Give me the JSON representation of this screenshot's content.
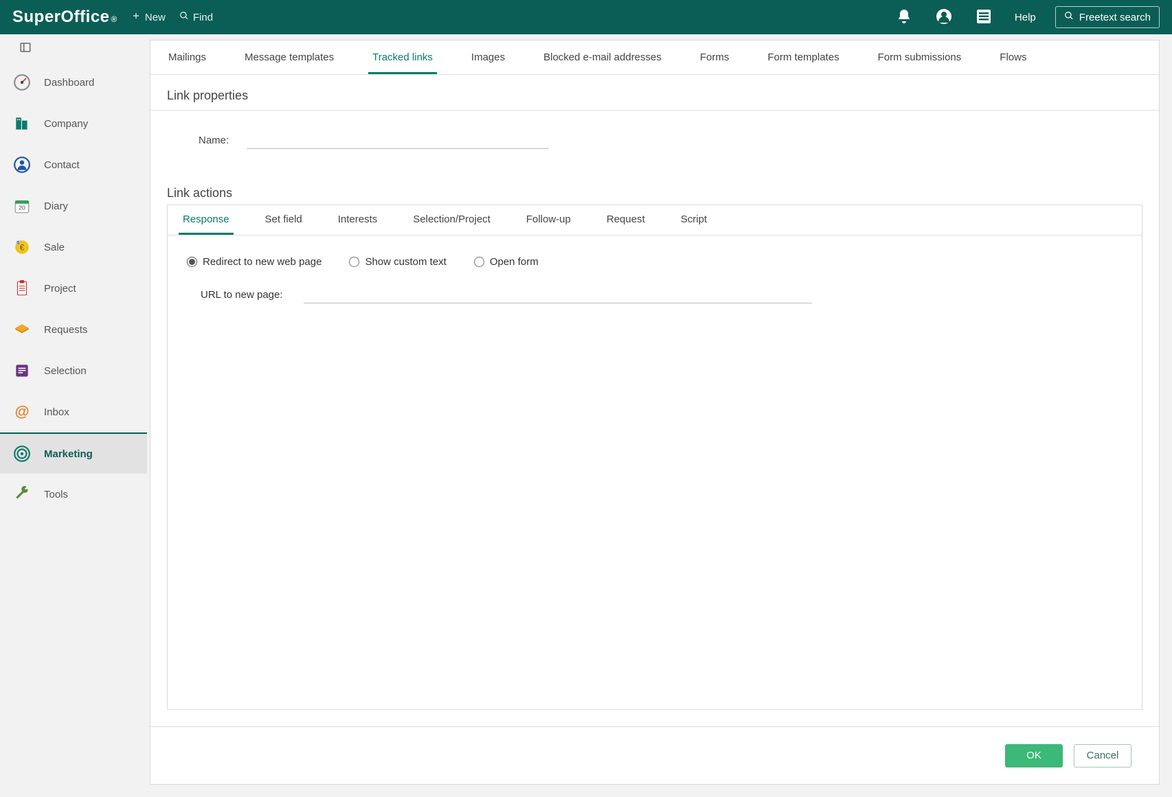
{
  "brand": "SuperOffice",
  "topbar": {
    "new_label": "New",
    "find_label": "Find",
    "help_label": "Help",
    "freetext_label": "Freetext search"
  },
  "sidebar": {
    "items": [
      {
        "key": "dashboard",
        "label": "Dashboard"
      },
      {
        "key": "company",
        "label": "Company"
      },
      {
        "key": "contact",
        "label": "Contact"
      },
      {
        "key": "diary",
        "label": "Diary"
      },
      {
        "key": "sale",
        "label": "Sale"
      },
      {
        "key": "project",
        "label": "Project"
      },
      {
        "key": "requests",
        "label": "Requests"
      },
      {
        "key": "selection",
        "label": "Selection"
      },
      {
        "key": "inbox",
        "label": "Inbox"
      },
      {
        "key": "marketing",
        "label": "Marketing"
      },
      {
        "key": "tools",
        "label": "Tools"
      }
    ],
    "active_key": "marketing"
  },
  "toptabs": {
    "items": [
      "Mailings",
      "Message templates",
      "Tracked links",
      "Images",
      "Blocked e-mail addresses",
      "Forms",
      "Form templates",
      "Form submissions",
      "Flows"
    ],
    "active_index": 2
  },
  "page": {
    "title": "Link properties",
    "name_label": "Name:",
    "name_value": "",
    "link_actions_title": "Link actions"
  },
  "subtabs": {
    "items": [
      "Response",
      "Set field",
      "Interests",
      "Selection/Project",
      "Follow-up",
      "Request",
      "Script"
    ],
    "active_index": 0
  },
  "response": {
    "radios": [
      {
        "key": "redirect",
        "label": "Redirect to new web page"
      },
      {
        "key": "custom",
        "label": "Show custom text"
      },
      {
        "key": "openform",
        "label": "Open form"
      }
    ],
    "selected_key": "redirect",
    "url_label": "URL to new page:",
    "url_value": ""
  },
  "footer": {
    "ok_label": "OK",
    "cancel_label": "Cancel"
  },
  "colors": {
    "accent": "#0a5e55",
    "tab_active": "#0a7a6c",
    "ok_bg": "#3cb878"
  }
}
